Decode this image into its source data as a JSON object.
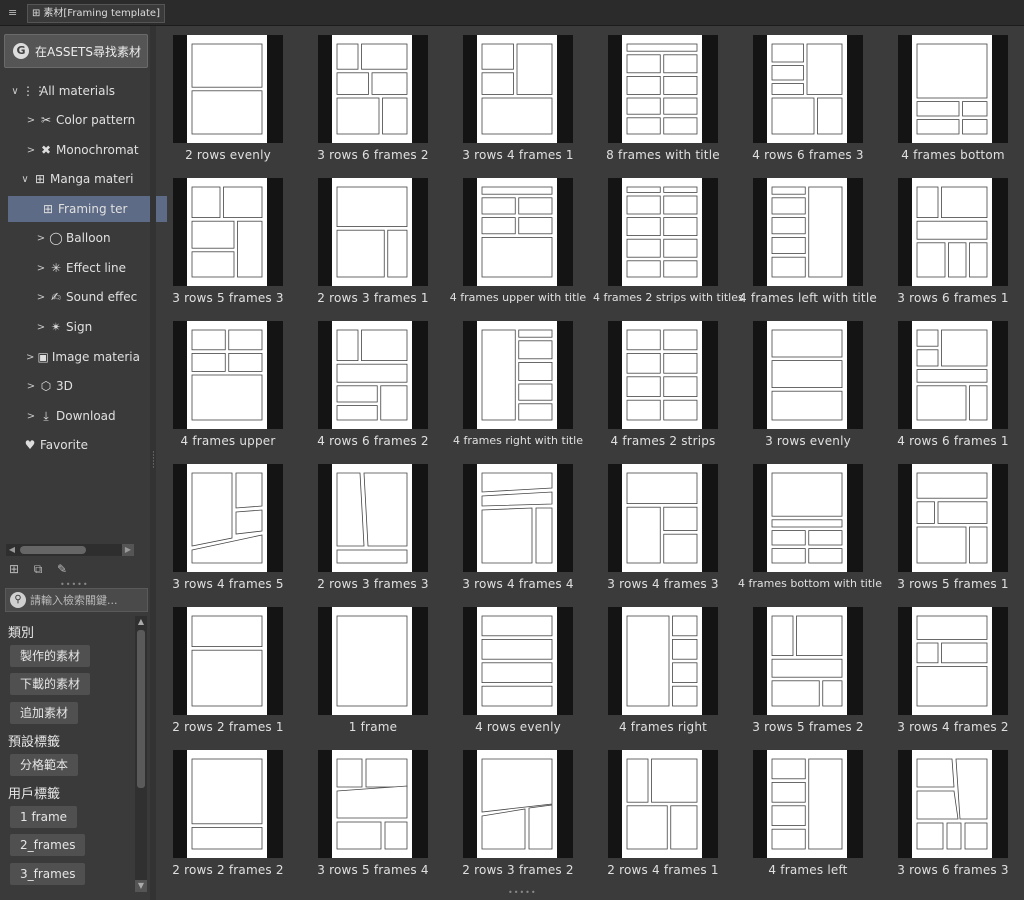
{
  "window": {
    "menu_glyph": "≡",
    "tab_title": "素材[Framing template]"
  },
  "sidebar": {
    "assets_button": "在ASSETS尋找素材",
    "tree": [
      {
        "label": "All materials",
        "icon": "grid-dots-icon",
        "glyph": "⋮⋮",
        "chev": "∨"
      },
      {
        "label": "Color pattern",
        "icon": "color-pattern-icon",
        "glyph": "✂",
        "chev": ">"
      },
      {
        "label": "Monochromat",
        "icon": "monochromatic-icon",
        "glyph": "✖",
        "chev": ">"
      },
      {
        "label": "Manga materi",
        "icon": "manga-folder-icon",
        "glyph": "⊞",
        "chev": "∨"
      },
      {
        "label": "Framing ter",
        "icon": "framing-template-icon",
        "glyph": "⊞",
        "chev": ""
      },
      {
        "label": "Balloon",
        "icon": "balloon-icon",
        "glyph": "◯",
        "chev": ">"
      },
      {
        "label": "Effect line",
        "icon": "effect-line-icon",
        "glyph": "✳",
        "chev": ">"
      },
      {
        "label": "Sound effec",
        "icon": "sound-effect-icon",
        "glyph": "✍",
        "chev": ">"
      },
      {
        "label": "Sign",
        "icon": "sign-icon",
        "glyph": "✴",
        "chev": ">"
      },
      {
        "label": "Image materia",
        "icon": "image-icon",
        "glyph": "▣",
        "chev": ">"
      },
      {
        "label": "3D",
        "icon": "cube-icon",
        "glyph": "⬡",
        "chev": ">"
      },
      {
        "label": "Download",
        "icon": "download-icon",
        "glyph": "⤓",
        "chev": ">"
      },
      {
        "label": "Favorite",
        "icon": "heart-icon",
        "glyph": "♥",
        "chev": ""
      }
    ],
    "search_placeholder": "請輸入檢索關鍵...",
    "category_header": "類別",
    "category_tags": [
      "製作的素材",
      "下載的素材",
      "追加素材"
    ],
    "preset_header": "預設標籤",
    "preset_tags": [
      "分格範本"
    ],
    "user_header": "用戶標籤",
    "user_tags": [
      "1 frame",
      "2_frames",
      "3_frames"
    ]
  },
  "grid": {
    "items": [
      {
        "label": "2 rows evenly",
        "layout": "rows2-even"
      },
      {
        "label": "3 rows 6 frames 2",
        "layout": "r3f6-2"
      },
      {
        "label": "3 rows 4 frames 1",
        "layout": "r3f4-1"
      },
      {
        "label": "8 frames with title",
        "layout": "f8-title"
      },
      {
        "label": "4 rows 6 frames 3",
        "layout": "r4f6-3"
      },
      {
        "label": "4 frames bottom",
        "layout": "f4-bottom"
      },
      {
        "label": "3 rows 5 frames 3",
        "layout": "r3f5-3"
      },
      {
        "label": "2 rows 3 frames 1",
        "layout": "r2f3-1"
      },
      {
        "label": "4 frames upper with title",
        "layout": "f4-upper-title"
      },
      {
        "label": "4 frames 2 strips with titles",
        "layout": "f4-2strips-titles"
      },
      {
        "label": "4 frames left with title",
        "layout": "f4-left-title"
      },
      {
        "label": "3 rows 6 frames 1",
        "layout": "r3f6-1"
      },
      {
        "label": "4 frames upper",
        "layout": "f4-upper"
      },
      {
        "label": "4 rows 6 frames 2",
        "layout": "r4f6-2"
      },
      {
        "label": "4 frames right with title",
        "layout": "f4-right-title"
      },
      {
        "label": "4 frames 2 strips",
        "layout": "f4-2strips"
      },
      {
        "label": "3 rows evenly",
        "layout": "rows3-even"
      },
      {
        "label": "4 rows 6 frames 1",
        "layout": "r4f6-1"
      },
      {
        "label": "3 rows 4 frames 5",
        "layout": "r3f4-5"
      },
      {
        "label": "2 rows 3 frames 3",
        "layout": "r2f3-3"
      },
      {
        "label": "3 rows 4 frames 4",
        "layout": "r3f4-4"
      },
      {
        "label": "3 rows 4 frames 3",
        "layout": "r3f4-3"
      },
      {
        "label": "4 frames bottom with title",
        "layout": "f4-bottom-title"
      },
      {
        "label": "3 rows 5 frames 1",
        "layout": "r3f5-1"
      },
      {
        "label": "2 rows 2 frames 1",
        "layout": "r2f2-1"
      },
      {
        "label": "1 frame",
        "layout": "f1"
      },
      {
        "label": "4 rows evenly",
        "layout": "rows4-even"
      },
      {
        "label": "4 frames right",
        "layout": "f4-right"
      },
      {
        "label": "3 rows 5 frames 2",
        "layout": "r3f5-2"
      },
      {
        "label": "3 rows 4 frames 2",
        "layout": "r3f4-2"
      },
      {
        "label": "2 rows 2 frames 2",
        "layout": "r2f2-2"
      },
      {
        "label": "3 rows 5 frames 4",
        "layout": "r3f5-4"
      },
      {
        "label": "2 rows 3 frames 2",
        "layout": "r2f3-2"
      },
      {
        "label": "2 rows 4 frames 1",
        "layout": "r2f4-1"
      },
      {
        "label": "4 frames left",
        "layout": "f4-left"
      },
      {
        "label": "3 rows 6 frames 3",
        "layout": "r3f6-3"
      }
    ]
  }
}
